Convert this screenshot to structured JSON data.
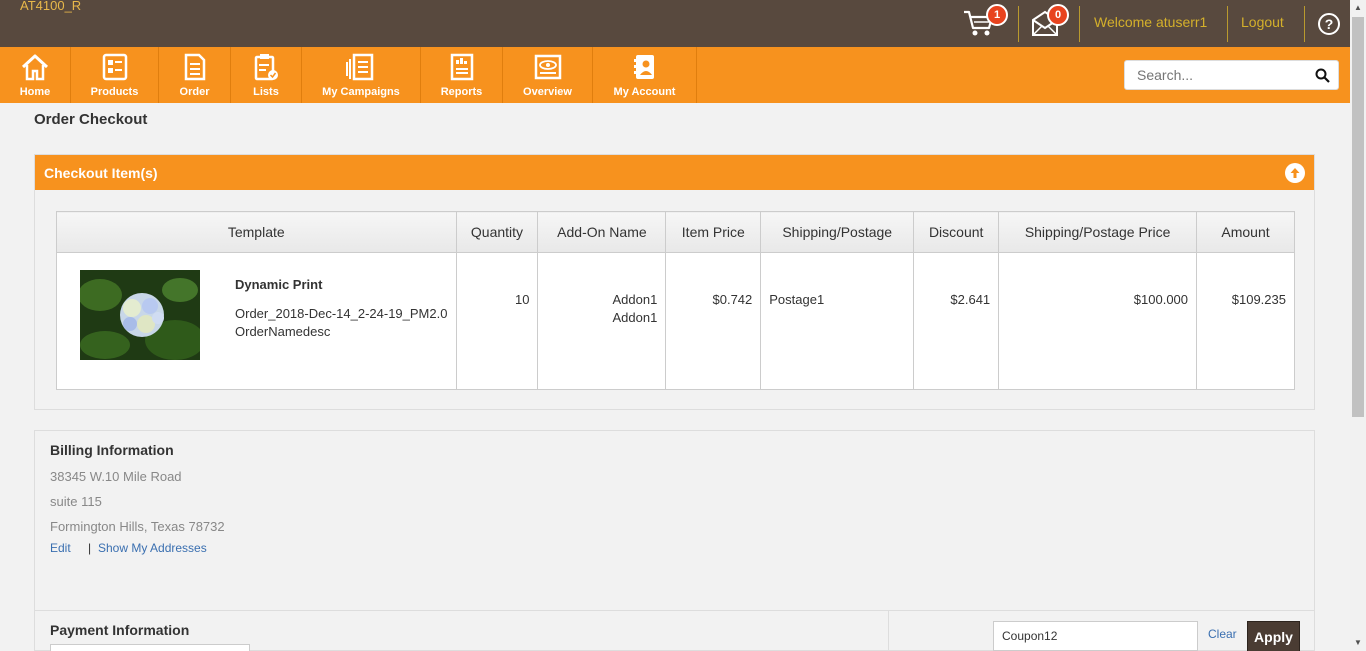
{
  "header": {
    "tenant": "AT4100_R",
    "cart_count": "1",
    "mail_count": "0",
    "welcome": "Welcome atuserr1",
    "logout": "Logout",
    "help": "?"
  },
  "nav": {
    "items": [
      {
        "label": "Home",
        "icon": "home-icon"
      },
      {
        "label": "Products",
        "icon": "products-icon"
      },
      {
        "label": "Order",
        "icon": "order-icon"
      },
      {
        "label": "Lists",
        "icon": "lists-icon"
      },
      {
        "label": "My Campaigns",
        "icon": "campaigns-icon"
      },
      {
        "label": "Reports",
        "icon": "reports-icon"
      },
      {
        "label": "Overview",
        "icon": "overview-icon"
      },
      {
        "label": "My Account",
        "icon": "account-icon"
      }
    ],
    "search_placeholder": "Search..."
  },
  "page": {
    "title": "Order Checkout"
  },
  "checkout": {
    "panel_title": "Checkout Item(s)",
    "columns": [
      "Template",
      "Quantity",
      "Add-On Name",
      "Item Price",
      "Shipping/Postage",
      "Discount",
      "Shipping/Postage Price",
      "Amount"
    ],
    "row": {
      "template_name": "Dynamic Print",
      "order_name": "Order_2018-Dec-14_2-24-19_PM2.0",
      "order_desc": "OrderNamedesc",
      "quantity": "10",
      "addon_1": "Addon1",
      "addon_2": "Addon1",
      "item_price": "$0.742",
      "shipping": "Postage1",
      "discount": "$2.641",
      "shipping_price": "$100.000",
      "amount": "$109.235"
    }
  },
  "billing": {
    "title": "Billing Information",
    "line1": "38345 W.10 Mile Road",
    "line2": "suite 115",
    "line3": "Formington Hills, Texas 78732",
    "edit": "Edit",
    "separator": "|",
    "show_addresses": "Show My Addresses"
  },
  "payment": {
    "title": "Payment Information",
    "coupon_value": "Coupon12",
    "clear": "Clear",
    "apply": "Apply"
  },
  "colors": {
    "topbar": "#58493e",
    "nav": "#f7921e",
    "accent_text": "#d4b02b",
    "badge": "#e8431e",
    "link": "#3a6fb0"
  }
}
